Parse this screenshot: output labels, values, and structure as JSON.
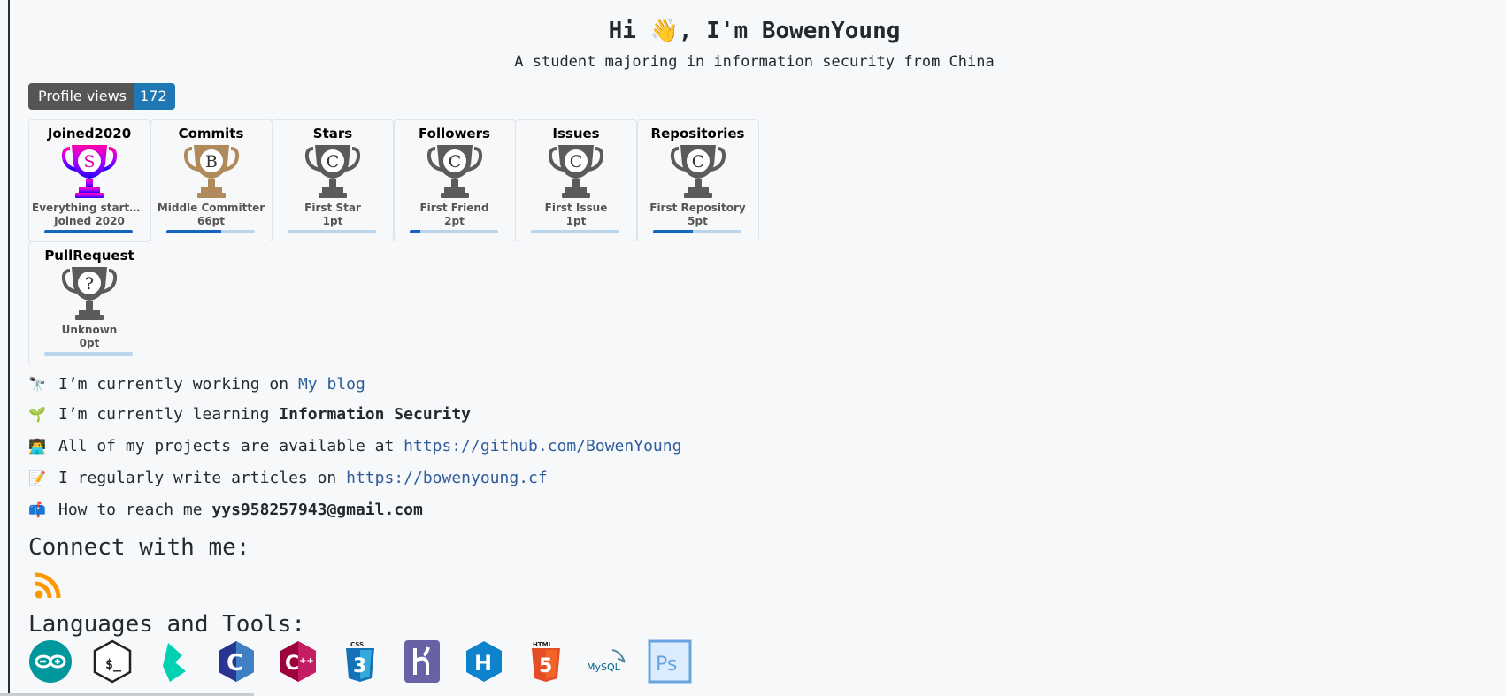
{
  "header": {
    "title": "Hi 👋, I'm BowenYoung",
    "subtitle": "A student majoring in information security from China"
  },
  "badge": {
    "label": "Profile views",
    "value": "172"
  },
  "trophies": [
    {
      "name": "Joined2020",
      "rank": "S",
      "desc": "Everything started...",
      "points": "Joined 2020",
      "progress": 1.0,
      "color": "rainbow"
    },
    {
      "name": "Commits",
      "rank": "B",
      "desc": "Middle Committer",
      "points": "66pt",
      "progress": 0.62,
      "color": "#b08a5a"
    },
    {
      "name": "Stars",
      "rank": "C",
      "desc": "First Star",
      "points": "1pt",
      "progress": 0.0,
      "color": "#5b5b5b"
    },
    {
      "name": "Followers",
      "rank": "C",
      "desc": "First Friend",
      "points": "2pt",
      "progress": 0.12,
      "color": "#5b5b5b"
    },
    {
      "name": "Issues",
      "rank": "C",
      "desc": "First Issue",
      "points": "1pt",
      "progress": 0.0,
      "color": "#5b5b5b"
    },
    {
      "name": "Repositories",
      "rank": "C",
      "desc": "First Repository",
      "points": "5pt",
      "progress": 0.45,
      "color": "#5b5b5b"
    },
    {
      "name": "PullRequest",
      "rank": "?",
      "desc": "Unknown",
      "points": "0pt",
      "progress": 0.0,
      "color": "#5b5b5b"
    }
  ],
  "about": {
    "working": {
      "icon": "telescope-icon",
      "emoji": "🔭",
      "text": "I’m currently working on ",
      "link": "My blog"
    },
    "learning": {
      "icon": "seedling-icon",
      "emoji": "🌱",
      "text": "I’m currently learning ",
      "bold": "Information Security"
    },
    "projects": {
      "icon": "technologist-icon",
      "emoji": "👨‍💻",
      "text": "All of my projects are available at ",
      "link": "https://github.com/BowenYoung"
    },
    "articles": {
      "icon": "memo-icon",
      "emoji": "📝",
      "text": "I regularly write articles on ",
      "link": "https://bowenyoung.cf"
    },
    "contact": {
      "icon": "mailbox-icon",
      "emoji": "📫",
      "text": "How to reach me ",
      "bold": "yys958257943@gmail.com"
    }
  },
  "connect": {
    "heading": "Connect with me:",
    "rss_icon": "rss-icon",
    "rss_color": "#ff9800"
  },
  "tools": {
    "heading": "Languages and Tools:",
    "items": [
      "arduino-icon",
      "bash-icon",
      "bulma-icon",
      "c-icon",
      "cplusplus-icon",
      "css3-icon",
      "heroku-icon",
      "hexo-icon",
      "html5-icon",
      "mysql-icon",
      "photoshop-icon"
    ],
    "css_label": "CSS",
    "html_label": "HTML",
    "mysql_label": "MySQL",
    "ps_label": "Ps"
  }
}
